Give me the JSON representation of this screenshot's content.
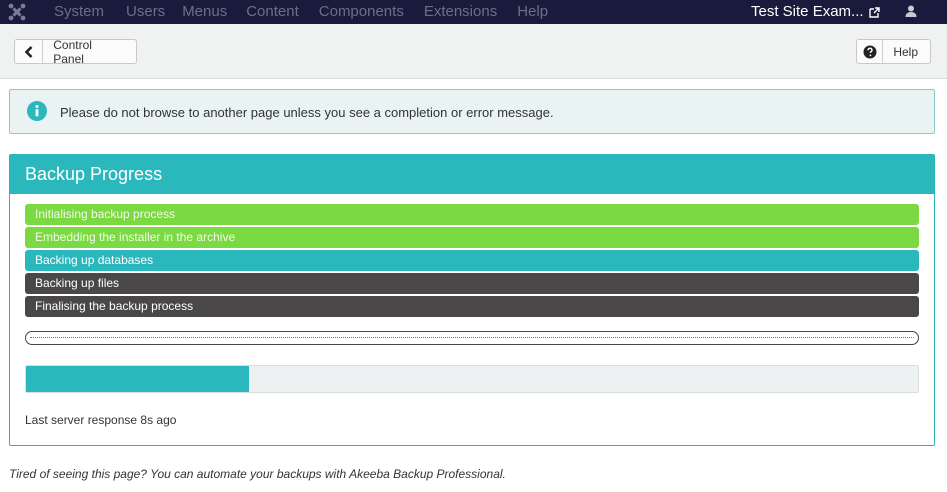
{
  "navbar": {
    "menu": [
      "System",
      "Users",
      "Menus",
      "Content",
      "Components",
      "Extensions",
      "Help"
    ],
    "site_name": "Test Site Exam..."
  },
  "toolbar": {
    "back_label": "Control Panel",
    "help_label": "Help"
  },
  "alert": {
    "message": "Please do not browse to another page unless you see a completion or error message."
  },
  "panel": {
    "title": "Backup Progress",
    "steps": [
      {
        "label": "Initialising backup process",
        "status": "done"
      },
      {
        "label": "Embedding the installer in the archive",
        "status": "done"
      },
      {
        "label": "Backing up databases",
        "status": "active"
      },
      {
        "label": "Backing up files",
        "status": "pending"
      },
      {
        "label": "Finalising the backup process",
        "status": "pending"
      }
    ],
    "progress_fraction": 0.25,
    "server_response": "Last server response 8s ago"
  },
  "footer": {
    "text": "Tired of seeing this page? You can automate your backups with Akeeba Backup Professional."
  },
  "colors": {
    "navbar": "#1a1a3d",
    "accent": "#2bb8bd",
    "done": "#7bd942",
    "pending": "#4a4748"
  }
}
